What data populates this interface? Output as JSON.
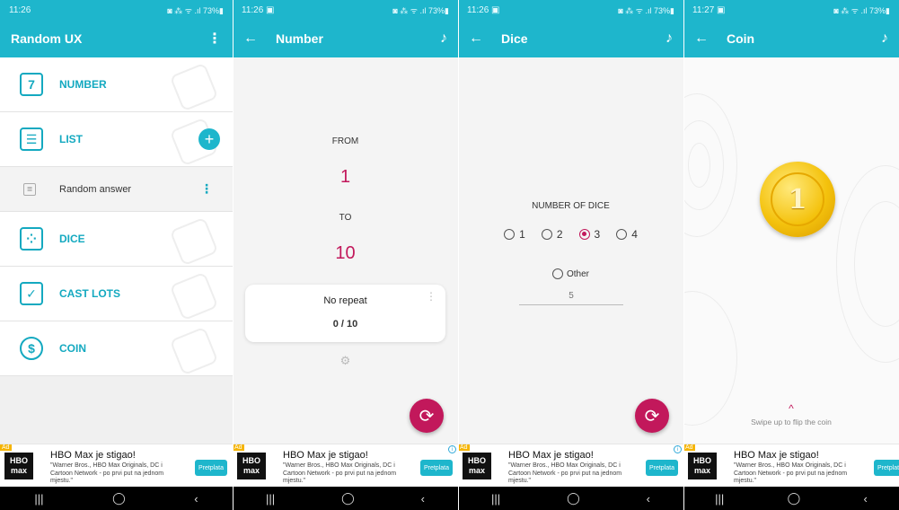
{
  "screens": {
    "menu": {
      "time": "11:26",
      "status_right": "◙ ⁂ ᯤ .ıl 73%▮",
      "title": "Random UX",
      "overflow": "⋮",
      "items": [
        {
          "label": "NUMBER",
          "glyph": "7"
        },
        {
          "label": "LIST",
          "glyph": "☰"
        },
        {
          "label": "DICE",
          "glyph": "⁘"
        },
        {
          "label": "CAST LOTS",
          "glyph": "✓"
        },
        {
          "label": "COIN",
          "glyph": "$"
        }
      ],
      "add_glyph": "+",
      "sub_item": {
        "label": "Random answer",
        "glyph": "≣",
        "more": "⋮"
      }
    },
    "number": {
      "time": "11:26 ▣",
      "status_right": "◙ ⁂ ᯤ .ıl 73%▮",
      "back": "←",
      "title": "Number",
      "music": "♪",
      "from_label": "FROM",
      "from_value": "1",
      "to_label": "TO",
      "to_value": "10",
      "repeat_label": "No repeat",
      "repeat_count": "0 / 10",
      "card_more": "⋮",
      "gear": "⚙",
      "refresh": "⟳"
    },
    "dice": {
      "time": "11:26 ▣",
      "status_right": "◙ ⁂ ᯤ .ıl 73%▮",
      "back": "←",
      "title": "Dice",
      "music": "♪",
      "count_label": "NUMBER OF DICE",
      "options": [
        "1",
        "2",
        "3",
        "4"
      ],
      "selected": "3",
      "other_label": "Other",
      "other_placeholder": "5",
      "refresh": "⟳"
    },
    "coin": {
      "time": "11:27 ▣",
      "status_right": "◙ ⁂ ᯤ .ıl 73%▮",
      "back": "←",
      "title": "Coin",
      "music": "♪",
      "coin_face": "1",
      "swipe_arrow": "^",
      "swipe_text": "Swipe up to flip the coin"
    }
  },
  "ad": {
    "tag": "Ad",
    "info": "i",
    "logo": "HBO\nmax",
    "headline": "HBO Max je stigao!",
    "description": "\"Warner Bros., HBO Max Originals, DC i Cartoon Network - po prvi put na jednom mjestu.\"",
    "cta": "Pretplata"
  },
  "navbar": {
    "recent": "|||",
    "home": "◯",
    "back": "‹"
  },
  "colors": {
    "teal": "#1eb6cc",
    "accent": "#c2185b",
    "coin": "#f4c20d"
  }
}
